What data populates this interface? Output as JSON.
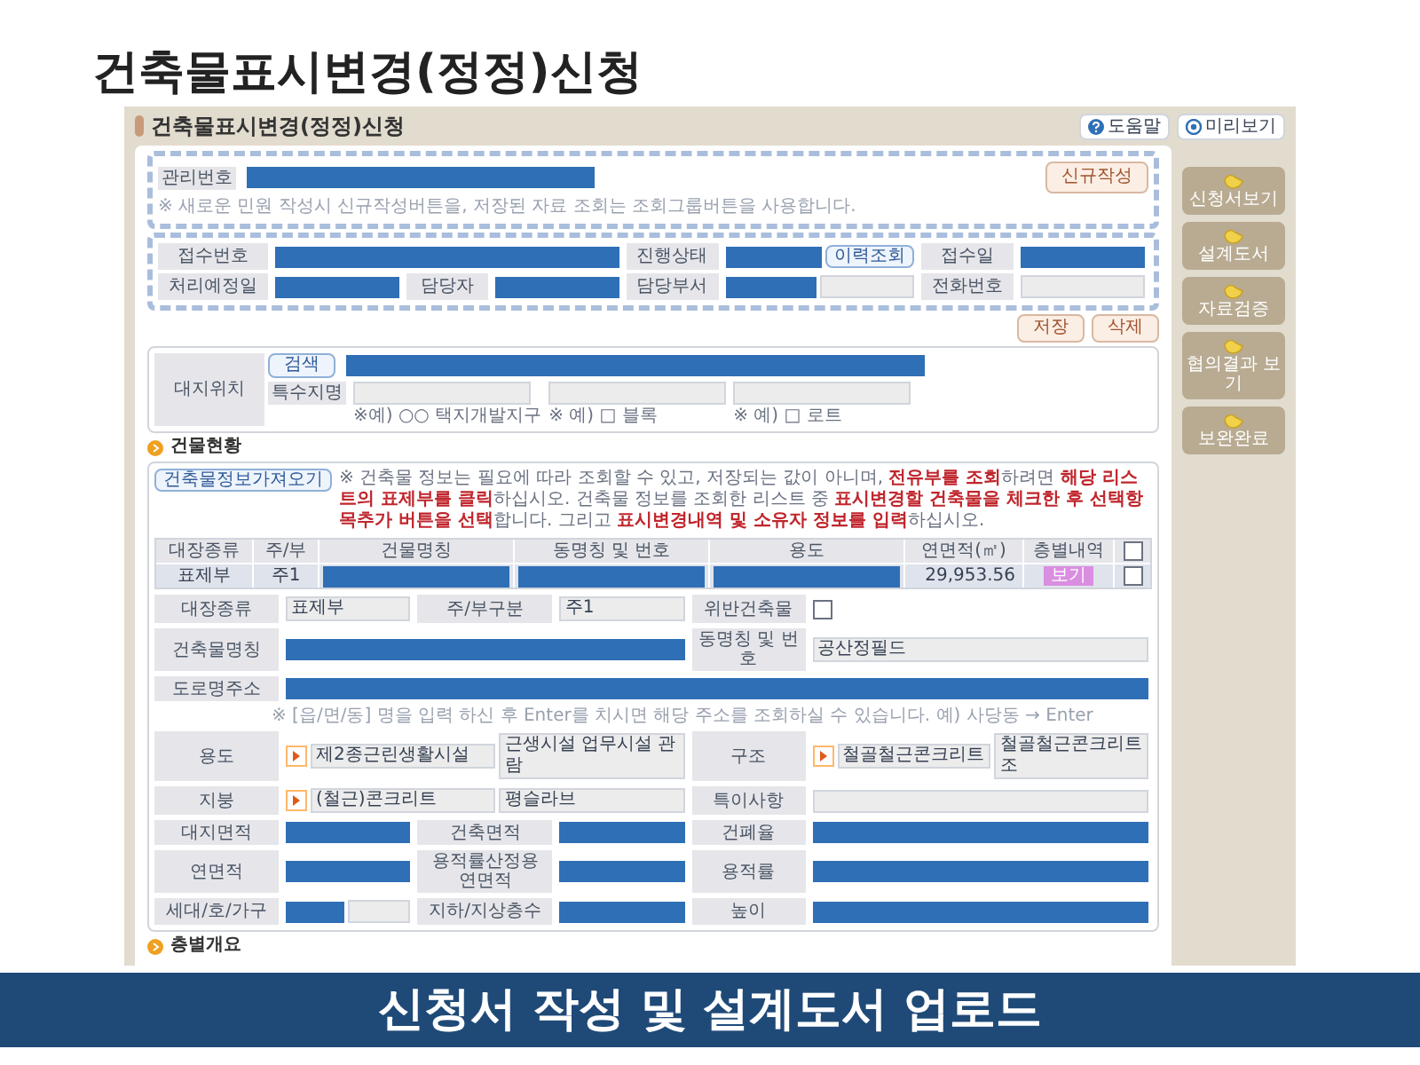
{
  "slide_title": "건축물표시변경(정정)신청",
  "slide_caption": "신청서 작성 및 설계도서 업로드",
  "app": {
    "title": "건축물표시변경(정정)신청",
    "header_buttons": [
      {
        "label": "도움말",
        "kind": "help"
      },
      {
        "label": "미리보기",
        "kind": "preview"
      }
    ],
    "management": {
      "label": "관리번호",
      "fields": [
        {
          "kind": "redacted"
        }
      ],
      "button": "신규작성",
      "note": "※ 새로운 민원 작성시 신규작성버튼을, 저장된 자료 조회는 조회그룹버튼을 사용합니다."
    },
    "receipt_rows": [
      [
        {
          "label": "접수번호",
          "fields": [
            {
              "kind": "redacted"
            }
          ]
        },
        {
          "label": "진행상태",
          "fields": [
            {
              "kind": "redacted"
            }
          ],
          "button": "이력조회"
        },
        {
          "label": "접수일",
          "fields": [
            {
              "kind": "redacted"
            }
          ]
        }
      ],
      [
        {
          "label": "처리예정일",
          "fields": [
            {
              "kind": "redacted"
            }
          ]
        },
        {
          "label": "담당자",
          "fields": [
            {
              "kind": "redacted"
            }
          ]
        },
        {
          "label": "담당부서",
          "fields": [
            {
              "kind": "redacted"
            },
            {
              "kind": "empty"
            }
          ]
        },
        {
          "label": "전화번호",
          "fields": [
            {
              "kind": "empty"
            }
          ]
        }
      ]
    ],
    "actions": [
      "저장",
      "삭제"
    ],
    "site": {
      "label": "대지위치",
      "search_button": "검색",
      "address": [
        {
          "kind": "redacted"
        }
      ],
      "special_label": "특수지명",
      "special_fields": [
        {
          "hint": "※예) ○○ 택지개발지구"
        },
        {
          "hint": "※ 예) □ 블록"
        },
        {
          "hint": "※ 예) □ 로트"
        }
      ]
    },
    "building": {
      "heading": "건물현황",
      "fetch_button": "건축물정보가져오기",
      "note": "※ 건축물 정보는 필요에 따라 조회할 수 있고, 저장되는 값이 아니며, **전유부를 조회**하려면 **해당 리스트의 표제부를 클릭**하십시오. 건축물 정보를 조회한 리스트 중 **표시변경할 건축물을 체크한 후 선택항목추가 버튼을 선택**합니다. 그리고 **표시변경내역 및 소유자 정보를 입력**하십시오.",
      "table": {
        "columns": [
          "대장종류",
          "주/부",
          "건물명칭",
          "동명칭 및 번호",
          "용도",
          "연면적(㎡)",
          "층별내역"
        ],
        "select_all": false,
        "rows": [
          {
            "cells": [
              {
                "kind": "text",
                "value": "표제부"
              },
              {
                "kind": "text",
                "value": "주1"
              },
              {
                "kind": "redacted"
              },
              {
                "kind": "redacted"
              },
              {
                "kind": "redacted"
              },
              {
                "kind": "number",
                "value": "29,953.56"
              },
              {
                "kind": "button",
                "value": "보기"
              }
            ],
            "checked": false
          }
        ]
      },
      "form_rows": [
        {
          "kind": "fields",
          "items": [
            {
              "label": "대장종류",
              "fields": [
                {
                  "kind": "input",
                  "value": "표제부"
                }
              ]
            },
            {
              "label": "주/부구분",
              "fields": [
                {
                  "kind": "input",
                  "value": "주1"
                }
              ]
            },
            {
              "label": "위반건축물",
              "fields": [
                {
                  "kind": "checkbox",
                  "checked": false
                }
              ]
            }
          ]
        },
        {
          "kind": "fields",
          "items": [
            {
              "label": "건축물명칭",
              "fields": [
                {
                  "kind": "redacted"
                }
              ]
            },
            {
              "label": "동명칭 및 번호",
              "fields": [
                {
                  "kind": "input",
                  "value": "공산정필드"
                }
              ]
            }
          ]
        },
        {
          "kind": "fields",
          "items": [
            {
              "label": "도로명주소",
              "fields": [
                {
                  "kind": "redacted"
                }
              ]
            }
          ]
        },
        {
          "kind": "note",
          "text": "※ [읍/면/동] 명을 입력 하신 후 Enter를 치시면 해당 주소를 조회하실 수 있습니다. 예) 사당동 → Enter"
        },
        {
          "kind": "fields",
          "items": [
            {
              "label": "용도",
              "fields": [
                {
                  "kind": "picker"
                },
                {
                  "kind": "input",
                  "value": "제2종근린생활시설"
                },
                {
                  "kind": "input",
                  "value": "근생시설 업무시설 관람"
                }
              ]
            },
            {
              "label": "구조",
              "fields": [
                {
                  "kind": "picker"
                },
                {
                  "kind": "input",
                  "value": "철골철근콘크리트"
                },
                {
                  "kind": "input",
                  "value": "철골철근콘크리트조"
                }
              ]
            }
          ]
        },
        {
          "kind": "fields",
          "items": [
            {
              "label": "지붕",
              "fields": [
                {
                  "kind": "picker"
                },
                {
                  "kind": "input",
                  "value": "(철근)콘크리트"
                },
                {
                  "kind": "input",
                  "value": "평슬라브"
                }
              ]
            },
            {
              "label": "특이사항",
              "fields": [
                {
                  "kind": "empty"
                }
              ]
            }
          ]
        },
        {
          "kind": "fields",
          "items": [
            {
              "label": "대지면적",
              "fields": [
                {
                  "kind": "redacted"
                }
              ]
            },
            {
              "label": "건축면적",
              "fields": [
                {
                  "kind": "redacted"
                }
              ]
            },
            {
              "label": "건폐율",
              "fields": [
                {
                  "kind": "redacted"
                }
              ]
            }
          ]
        },
        {
          "kind": "fields",
          "items": [
            {
              "label": "연면적",
              "fields": [
                {
                  "kind": "redacted"
                }
              ]
            },
            {
              "label": "용적률산정용 연면적",
              "fields": [
                {
                  "kind": "redacted"
                }
              ]
            },
            {
              "label": "용적률",
              "fields": [
                {
                  "kind": "redacted"
                }
              ]
            }
          ]
        },
        {
          "kind": "fields",
          "items": [
            {
              "label": "세대/호/가구",
              "fields": [
                {
                  "kind": "redacted"
                },
                {
                  "kind": "empty"
                }
              ]
            },
            {
              "label": "지하/지상층수",
              "fields": [
                {
                  "kind": "redacted"
                }
              ]
            },
            {
              "label": "높이",
              "fields": [
                {
                  "kind": "redacted"
                }
              ]
            }
          ]
        }
      ]
    },
    "next_heading": "층별개요",
    "side_buttons": [
      "신청서보기",
      "설계도서",
      "자료검증",
      "협의결과 보기",
      "보완완료"
    ]
  }
}
